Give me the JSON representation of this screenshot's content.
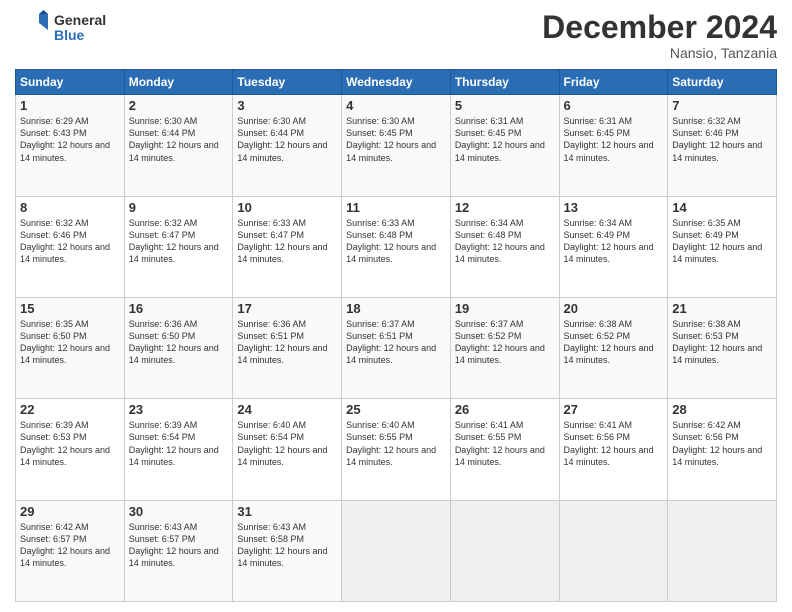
{
  "logo": {
    "line1": "General",
    "line2": "Blue"
  },
  "title": "December 2024",
  "location": "Nansio, Tanzania",
  "days_of_week": [
    "Sunday",
    "Monday",
    "Tuesday",
    "Wednesday",
    "Thursday",
    "Friday",
    "Saturday"
  ],
  "weeks": [
    [
      {
        "day": "1",
        "sunrise": "6:29 AM",
        "sunset": "6:43 PM",
        "daylight": "12 hours and 14 minutes."
      },
      {
        "day": "2",
        "sunrise": "6:30 AM",
        "sunset": "6:44 PM",
        "daylight": "12 hours and 14 minutes."
      },
      {
        "day": "3",
        "sunrise": "6:30 AM",
        "sunset": "6:44 PM",
        "daylight": "12 hours and 14 minutes."
      },
      {
        "day": "4",
        "sunrise": "6:30 AM",
        "sunset": "6:45 PM",
        "daylight": "12 hours and 14 minutes."
      },
      {
        "day": "5",
        "sunrise": "6:31 AM",
        "sunset": "6:45 PM",
        "daylight": "12 hours and 14 minutes."
      },
      {
        "day": "6",
        "sunrise": "6:31 AM",
        "sunset": "6:45 PM",
        "daylight": "12 hours and 14 minutes."
      },
      {
        "day": "7",
        "sunrise": "6:32 AM",
        "sunset": "6:46 PM",
        "daylight": "12 hours and 14 minutes."
      }
    ],
    [
      {
        "day": "8",
        "sunrise": "6:32 AM",
        "sunset": "6:46 PM",
        "daylight": "12 hours and 14 minutes."
      },
      {
        "day": "9",
        "sunrise": "6:32 AM",
        "sunset": "6:47 PM",
        "daylight": "12 hours and 14 minutes."
      },
      {
        "day": "10",
        "sunrise": "6:33 AM",
        "sunset": "6:47 PM",
        "daylight": "12 hours and 14 minutes."
      },
      {
        "day": "11",
        "sunrise": "6:33 AM",
        "sunset": "6:48 PM",
        "daylight": "12 hours and 14 minutes."
      },
      {
        "day": "12",
        "sunrise": "6:34 AM",
        "sunset": "6:48 PM",
        "daylight": "12 hours and 14 minutes."
      },
      {
        "day": "13",
        "sunrise": "6:34 AM",
        "sunset": "6:49 PM",
        "daylight": "12 hours and 14 minutes."
      },
      {
        "day": "14",
        "sunrise": "6:35 AM",
        "sunset": "6:49 PM",
        "daylight": "12 hours and 14 minutes."
      }
    ],
    [
      {
        "day": "15",
        "sunrise": "6:35 AM",
        "sunset": "6:50 PM",
        "daylight": "12 hours and 14 minutes."
      },
      {
        "day": "16",
        "sunrise": "6:36 AM",
        "sunset": "6:50 PM",
        "daylight": "12 hours and 14 minutes."
      },
      {
        "day": "17",
        "sunrise": "6:36 AM",
        "sunset": "6:51 PM",
        "daylight": "12 hours and 14 minutes."
      },
      {
        "day": "18",
        "sunrise": "6:37 AM",
        "sunset": "6:51 PM",
        "daylight": "12 hours and 14 minutes."
      },
      {
        "day": "19",
        "sunrise": "6:37 AM",
        "sunset": "6:52 PM",
        "daylight": "12 hours and 14 minutes."
      },
      {
        "day": "20",
        "sunrise": "6:38 AM",
        "sunset": "6:52 PM",
        "daylight": "12 hours and 14 minutes."
      },
      {
        "day": "21",
        "sunrise": "6:38 AM",
        "sunset": "6:53 PM",
        "daylight": "12 hours and 14 minutes."
      }
    ],
    [
      {
        "day": "22",
        "sunrise": "6:39 AM",
        "sunset": "6:53 PM",
        "daylight": "12 hours and 14 minutes."
      },
      {
        "day": "23",
        "sunrise": "6:39 AM",
        "sunset": "6:54 PM",
        "daylight": "12 hours and 14 minutes."
      },
      {
        "day": "24",
        "sunrise": "6:40 AM",
        "sunset": "6:54 PM",
        "daylight": "12 hours and 14 minutes."
      },
      {
        "day": "25",
        "sunrise": "6:40 AM",
        "sunset": "6:55 PM",
        "daylight": "12 hours and 14 minutes."
      },
      {
        "day": "26",
        "sunrise": "6:41 AM",
        "sunset": "6:55 PM",
        "daylight": "12 hours and 14 minutes."
      },
      {
        "day": "27",
        "sunrise": "6:41 AM",
        "sunset": "6:56 PM",
        "daylight": "12 hours and 14 minutes."
      },
      {
        "day": "28",
        "sunrise": "6:42 AM",
        "sunset": "6:56 PM",
        "daylight": "12 hours and 14 minutes."
      }
    ],
    [
      {
        "day": "29",
        "sunrise": "6:42 AM",
        "sunset": "6:57 PM",
        "daylight": "12 hours and 14 minutes."
      },
      {
        "day": "30",
        "sunrise": "6:43 AM",
        "sunset": "6:57 PM",
        "daylight": "12 hours and 14 minutes."
      },
      {
        "day": "31",
        "sunrise": "6:43 AM",
        "sunset": "6:58 PM",
        "daylight": "12 hours and 14 minutes."
      },
      null,
      null,
      null,
      null
    ]
  ]
}
